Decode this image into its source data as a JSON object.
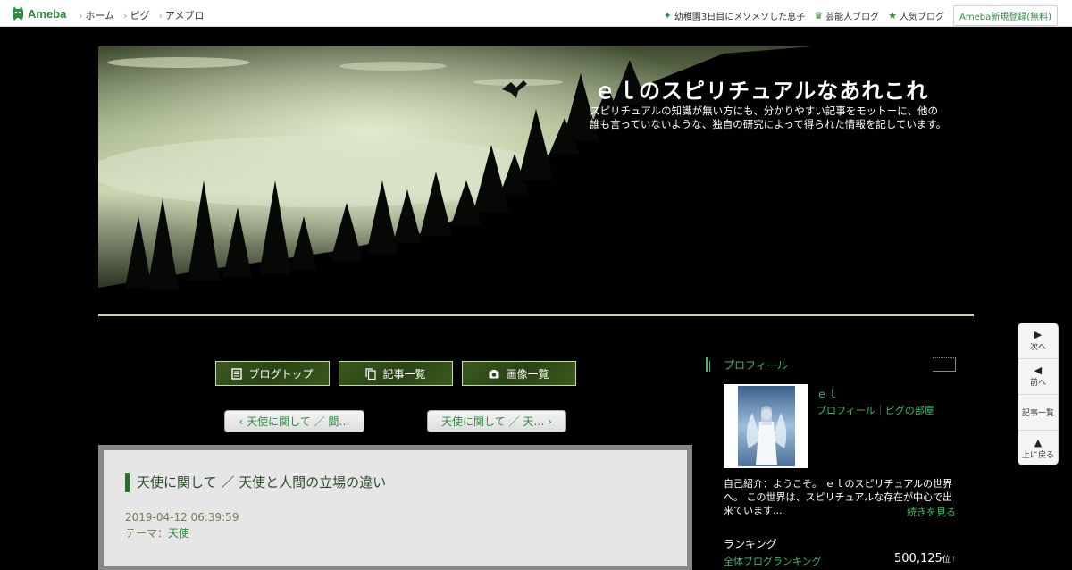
{
  "topbar": {
    "logo_text": "Ameba",
    "nav": [
      "ホーム",
      "ピグ",
      "アメブロ"
    ],
    "links": [
      {
        "icon": "sparkle-icon",
        "label": "幼稚園3日目にメソメソした息子"
      },
      {
        "icon": "crown-icon",
        "label": "芸能人ブログ"
      },
      {
        "icon": "star-icon",
        "label": "人気ブログ"
      }
    ],
    "register": "Ameba新規登録(無料)"
  },
  "header": {
    "title": "ｅｌのスピリチュアルなあれこれ",
    "description": "スピリチュアルの知識が無い方にも、分かりやすい記事をモットーに、他の誰も言っていないような、独自の研究によって得られた情報を記しています。"
  },
  "nav_buttons": [
    {
      "icon": "document-icon",
      "label": "ブログトップ"
    },
    {
      "icon": "copy-icon",
      "label": "記事一覧"
    },
    {
      "icon": "camera-icon",
      "label": "画像一覧"
    }
  ],
  "pager": {
    "prev": "‹ 天使に関して ／ 間…",
    "next": "天使に関して ／ 天… ›"
  },
  "article": {
    "title": "天使に関して ／ 天使と人間の立場の違い",
    "date": "2019-04-12 06:39:59",
    "theme_label": "テーマ：",
    "theme_value": "天使"
  },
  "sidebar": {
    "heading": "プロフィール",
    "name": "ｅｌ",
    "links": "プロフィール｜ピグの部屋",
    "intro": "自己紹介：ようこそ。 ｅｌのスピリチュアルの世界へ。 この世界は、スピリチュアルな存在が中心で出来ています...",
    "read_more": "続きを見る",
    "ranking_title": "ランキング",
    "ranking_label": "全体ブログランキング",
    "ranking_value": "500,125",
    "ranking_unit": "位",
    "ranking_trend": "↑"
  },
  "floatnav": [
    {
      "icon": "play-right-icon",
      "label": "次へ"
    },
    {
      "icon": "play-left-icon",
      "label": "前へ"
    },
    {
      "icon": "",
      "label": "記事一覧"
    },
    {
      "icon": "play-up-icon",
      "label": "上に戻る"
    }
  ],
  "colors": {
    "accent_green": "#3fb86b",
    "brand_green": "#2d8c3c",
    "background": "#000000"
  }
}
